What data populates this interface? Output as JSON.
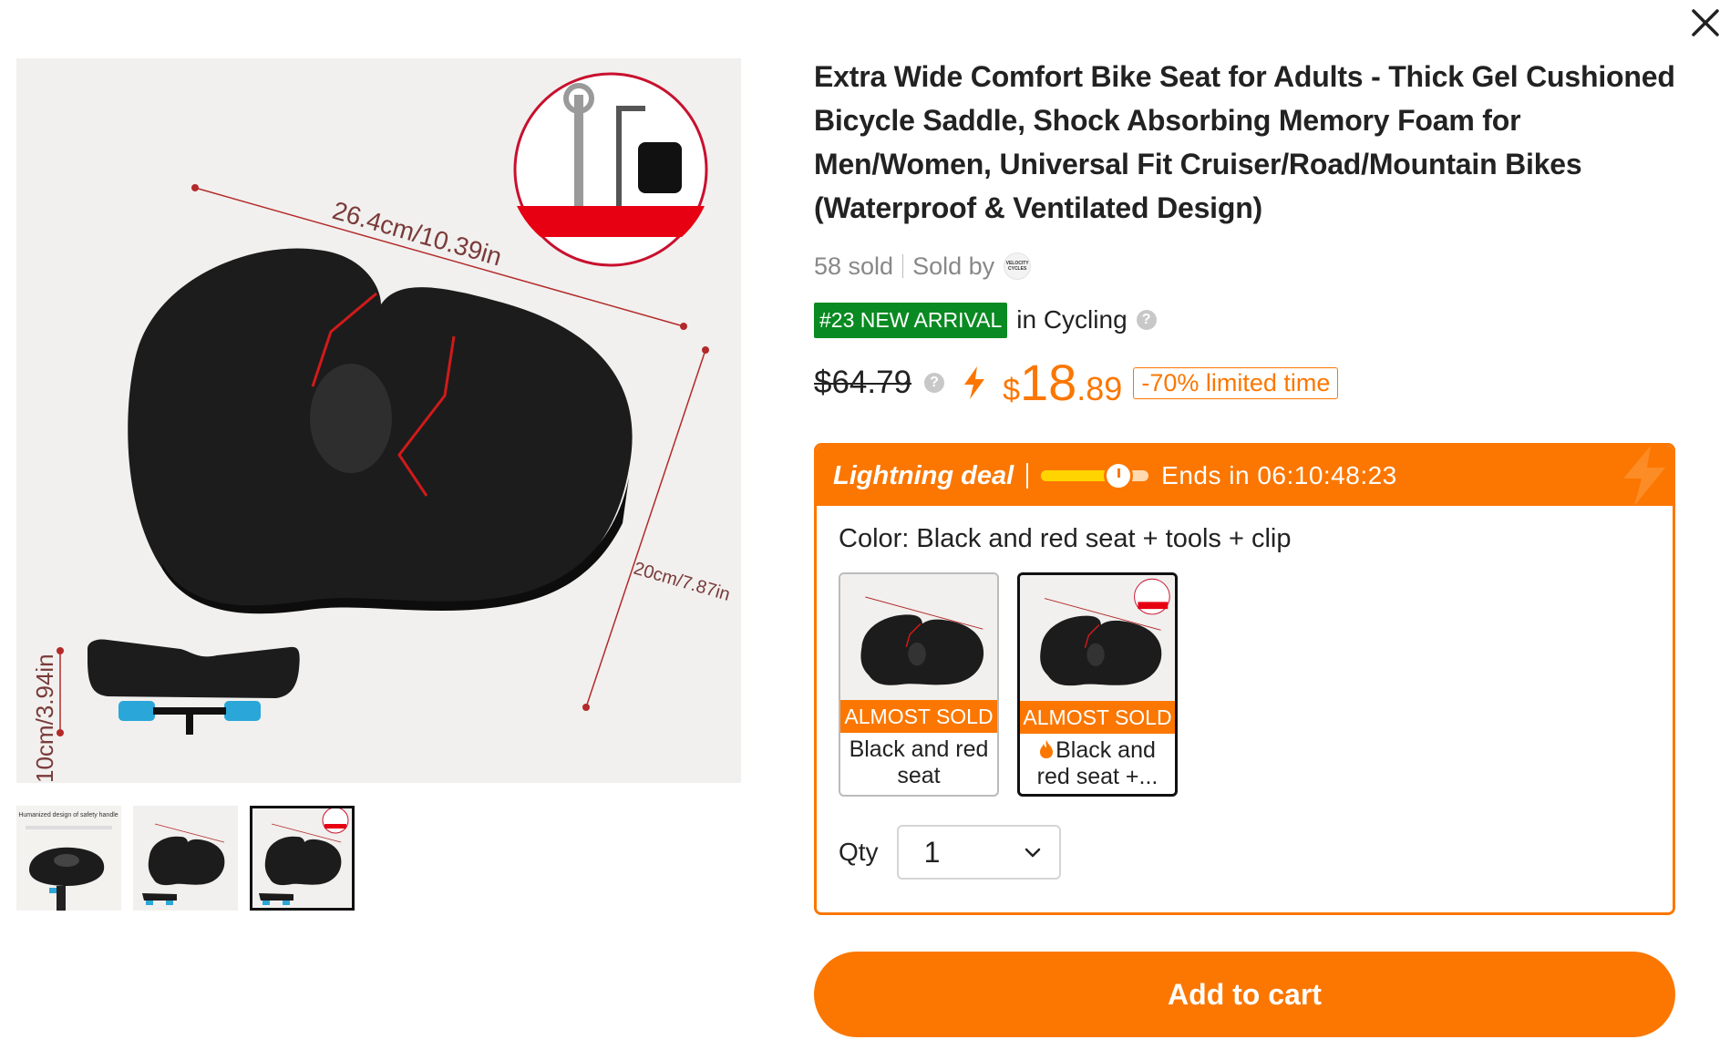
{
  "product": {
    "title": "Extra Wide Comfort Bike Seat for Adults - Thick Gel Cushioned Bicycle Saddle, Shock Absorbing Memory Foam for Men/Women, Universal Fit Cruiser/Road/Mountain Bikes (Waterproof & Ventilated Design)",
    "sold_count": "58 sold",
    "sold_by_label": "Sold by",
    "seller_logo_text": "VELOCITY CYCLES",
    "rank_badge": "#23 NEW ARRIVAL",
    "rank_category": "in Cycling"
  },
  "gallery": {
    "dimension_width": "26.4cm/10.39in",
    "dimension_depth": "20cm/7.87in",
    "dimension_height": "10cm/3.94in",
    "thumb1_caption": "Humanized design of safety handle",
    "selected_thumb_index": 3
  },
  "price": {
    "original": "$64.79",
    "currency": "$",
    "integer": "18",
    "decimal": ".89",
    "discount": "-70% limited time"
  },
  "deal": {
    "title": "Lightning deal",
    "ends_label": "Ends in 06:10:48:23",
    "progress": 0.72
  },
  "variant": {
    "color_label": "Color: Black and red seat + tools + clip",
    "options": [
      {
        "flag": "ALMOST SOLD",
        "label": "Black and red seat"
      },
      {
        "flag": "ALMOST SOLD",
        "label": "Black and red seat +..."
      }
    ]
  },
  "quantity": {
    "label": "Qty",
    "value": "1"
  },
  "actions": {
    "add_to_cart": "Add to cart"
  },
  "colors": {
    "accent": "#fb7701",
    "badge_green": "#0a8a22"
  }
}
